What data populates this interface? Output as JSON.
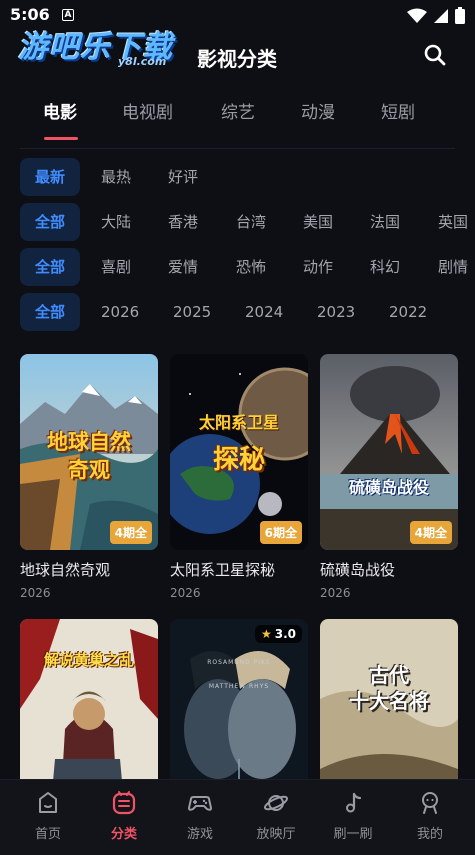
{
  "status": {
    "time": "5:06"
  },
  "header": {
    "logo_main": "游吧乐下载",
    "logo_sub": "y8l.com",
    "title": "影视分类"
  },
  "tabs": [
    {
      "label": "电影"
    },
    {
      "label": "电视剧"
    },
    {
      "label": "综艺"
    },
    {
      "label": "动漫"
    },
    {
      "label": "短剧"
    }
  ],
  "filters": {
    "sort": [
      "最新",
      "最热",
      "好评"
    ],
    "region": [
      "全部",
      "大陆",
      "香港",
      "台湾",
      "美国",
      "法国",
      "英国"
    ],
    "genre": [
      "全部",
      "喜剧",
      "爱情",
      "恐怖",
      "动作",
      "科幻",
      "剧情"
    ],
    "year": [
      "全部",
      "2026",
      "2025",
      "2024",
      "2023",
      "2022"
    ]
  },
  "cards": [
    {
      "title": "地球自然奇观",
      "year": "2026",
      "badge": "4期全",
      "poster_text": [
        "地球自然",
        "奇观"
      ]
    },
    {
      "title": "太阳系卫星探秘",
      "year": "2026",
      "badge": "6期全",
      "poster_text": [
        "太阳系卫星",
        "探秘"
      ]
    },
    {
      "title": "硫磺岛战役",
      "year": "2026",
      "badge": "4期全",
      "poster_text": [
        "硫磺岛战役"
      ]
    },
    {
      "title": "",
      "year": "",
      "poster_text": [
        "解说黄巢之乱"
      ]
    },
    {
      "title": "",
      "year": "",
      "rating": "3.0",
      "poster_text": [
        "ROSAMUND PIKE",
        "MATTHEW RHYS"
      ]
    },
    {
      "title": "",
      "year": "",
      "poster_text": [
        "古代",
        "十大名将"
      ]
    }
  ],
  "bottom_nav": [
    {
      "label": "首页",
      "icon": "home-face-icon"
    },
    {
      "label": "分类",
      "icon": "category-list-icon"
    },
    {
      "label": "游戏",
      "icon": "gamepad-icon"
    },
    {
      "label": "放映厅",
      "icon": "planet-icon"
    },
    {
      "label": "刷一刷",
      "icon": "music-note-icon"
    },
    {
      "label": "我的",
      "icon": "profile-icon"
    }
  ],
  "colors": {
    "accent": "#f05266",
    "chip_selected": "#3f8cff",
    "badge": "#e8a63a"
  }
}
